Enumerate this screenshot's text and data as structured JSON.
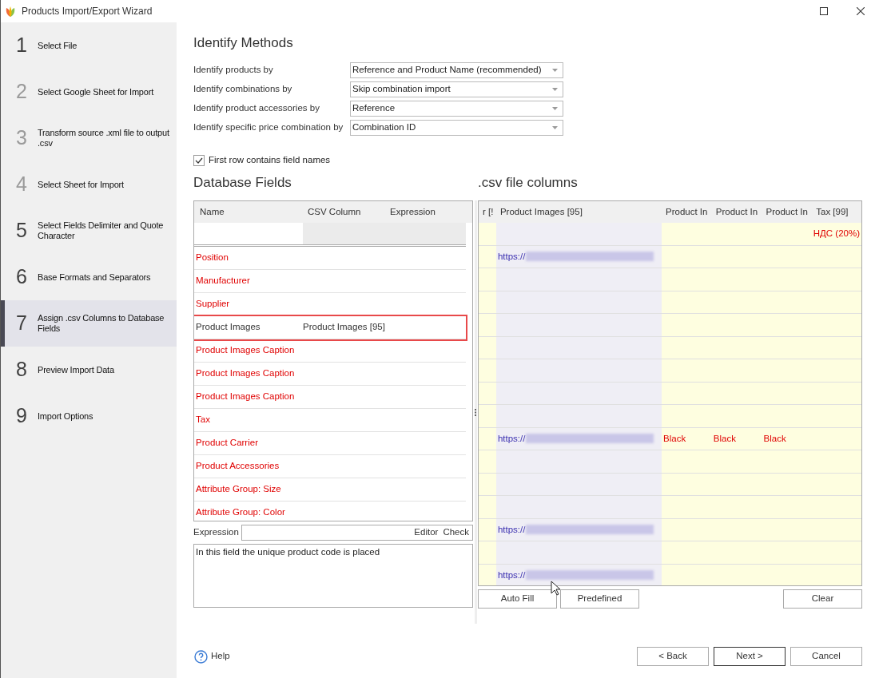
{
  "window": {
    "title": "Products Import/Export Wizard"
  },
  "steps": [
    {
      "number": "1",
      "label": "Select File",
      "selected": false,
      "disabled": false
    },
    {
      "number": "2",
      "label": "Select Google Sheet for Import",
      "selected": false,
      "disabled": true
    },
    {
      "number": "3",
      "label": "Transform source .xml file to output .csv",
      "selected": false,
      "disabled": true
    },
    {
      "number": "4",
      "label": "Select Sheet for Import",
      "selected": false,
      "disabled": true
    },
    {
      "number": "5",
      "label": "Select Fields Delimiter and Quote Character",
      "selected": false,
      "disabled": false
    },
    {
      "number": "6",
      "label": "Base Formats and Separators",
      "selected": false,
      "disabled": false
    },
    {
      "number": "7",
      "label": "Assign .csv Columns to Database Fields",
      "selected": true,
      "disabled": false
    },
    {
      "number": "8",
      "label": "Preview Import Data",
      "selected": false,
      "disabled": false
    },
    {
      "number": "9",
      "label": "Import Options",
      "selected": false,
      "disabled": false
    }
  ],
  "identify_methods": {
    "title": "Identify Methods",
    "rows": [
      {
        "label": "Identify products by",
        "value": "Reference and Product Name (recommended)"
      },
      {
        "label": "Identify combinations by",
        "value": "Skip combination import"
      },
      {
        "label": "Identify product accessories by",
        "value": "Reference"
      },
      {
        "label": "Identify specific price combination by",
        "value": "Combination ID"
      }
    ]
  },
  "first_row_checkbox": {
    "label": "First row contains field names",
    "checked": true
  },
  "database_fields": {
    "title": "Database Fields",
    "columns": [
      "Name",
      "CSV Column",
      "Expression"
    ],
    "rows": [
      {
        "name": "Position",
        "mapped": false,
        "highlighted": false
      },
      {
        "name": "Manufacturer",
        "mapped": false,
        "highlighted": false
      },
      {
        "name": "Supplier",
        "mapped": false,
        "highlighted": false
      },
      {
        "name": "Product Images",
        "csv_column": "Product Images [95]",
        "mapped": true,
        "highlighted": true
      },
      {
        "name": "Product Images Caption",
        "mapped": false,
        "highlighted": false
      },
      {
        "name": "Product Images Caption",
        "mapped": false,
        "highlighted": false
      },
      {
        "name": "Product Images Caption",
        "mapped": false,
        "highlighted": false
      },
      {
        "name": "Tax",
        "mapped": false,
        "highlighted": false
      },
      {
        "name": "Product Carrier",
        "mapped": false,
        "highlighted": false
      },
      {
        "name": "Product Accessories",
        "mapped": false,
        "highlighted": false
      },
      {
        "name": "Attribute Group: Size",
        "mapped": false,
        "highlighted": false
      },
      {
        "name": "Attribute Group: Color",
        "mapped": false,
        "highlighted": false
      }
    ]
  },
  "expression": {
    "label": "Expression",
    "buttons": [
      "Editor",
      "Check"
    ],
    "description": "In this field the unique product code is placed"
  },
  "csv_columns": {
    "title": ".csv file columns",
    "columns": [
      {
        "label": "r [!",
        "mapped": false
      },
      {
        "label": "Product Images [95]",
        "mapped": true
      },
      {
        "label": "Product In",
        "mapped": false
      },
      {
        "label": "Product In",
        "mapped": false
      },
      {
        "label": "Product In",
        "mapped": false
      },
      {
        "label": "Tax [99]",
        "mapped": false
      }
    ],
    "rows": [
      {
        "tax": "НДС (20%)"
      },
      {
        "image_url": "https://"
      },
      {},
      {},
      {},
      {},
      {},
      {},
      {},
      {
        "image_url": "https://",
        "attributes": [
          "Black",
          "Black",
          "Black"
        ]
      },
      {},
      {},
      {},
      {
        "image_url": "https://"
      },
      {},
      {
        "image_url": "https://"
      }
    ],
    "buttons": [
      "Auto Fill",
      "Predefined"
    ],
    "clear_button": "Clear"
  },
  "footer": {
    "help": "Help",
    "buttons": [
      {
        "label": "< Back",
        "default": false
      },
      {
        "label": "Next >",
        "default": true
      },
      {
        "label": "Cancel",
        "default": false
      }
    ]
  }
}
